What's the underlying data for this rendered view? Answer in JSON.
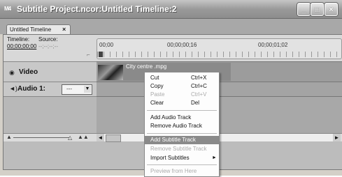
{
  "window": {
    "app_icon": "M4",
    "title": "Subtitle Project.ncor:Untitled Timeline:2",
    "buttons": [
      "minimize-icon",
      "maximize-icon",
      "close-icon"
    ]
  },
  "tab": {
    "label": "Untitled Timeline",
    "close": "×"
  },
  "timecode": {
    "timeline_label": "Timeline:",
    "timeline_value": "00;00;00;00",
    "source_label": "Source:",
    "source_value": "--;--;--;--"
  },
  "ruler": {
    "ticks": [
      "00;00",
      "00;00;00;16",
      "00;00;01;02"
    ]
  },
  "tracks": {
    "video": {
      "label": "Video",
      "clip_name": "City centre .mpg"
    },
    "audio": {
      "label": "Audio 1:",
      "select_value": "---"
    }
  },
  "context_menu": {
    "items": [
      {
        "label": "Cut",
        "shortcut": "Ctrl+X",
        "enabled": true
      },
      {
        "label": "Copy",
        "shortcut": "Ctrl+C",
        "enabled": true
      },
      {
        "label": "Paste",
        "shortcut": "Ctrl+V",
        "enabled": false
      },
      {
        "label": "Clear",
        "shortcut": "Del",
        "enabled": true
      },
      {
        "label": "Add Audio Track",
        "shortcut": "",
        "enabled": true
      },
      {
        "label": "Remove Audio Track",
        "shortcut": "",
        "enabled": true
      },
      {
        "label": "Add Subtitle Track",
        "shortcut": "",
        "enabled": true,
        "highlighted": true
      },
      {
        "label": "Remove Subtitle Track",
        "shortcut": "",
        "enabled": false
      },
      {
        "label": "Import Subtitles",
        "shortcut": "",
        "enabled": true,
        "submenu": true
      },
      {
        "label": "Preview from Here",
        "shortcut": "",
        "enabled": false
      }
    ]
  },
  "colors": {
    "title_gradient": "#9a9a9a",
    "highlight": "#8a8a8a",
    "disabled_text": "#aaaaaa"
  }
}
